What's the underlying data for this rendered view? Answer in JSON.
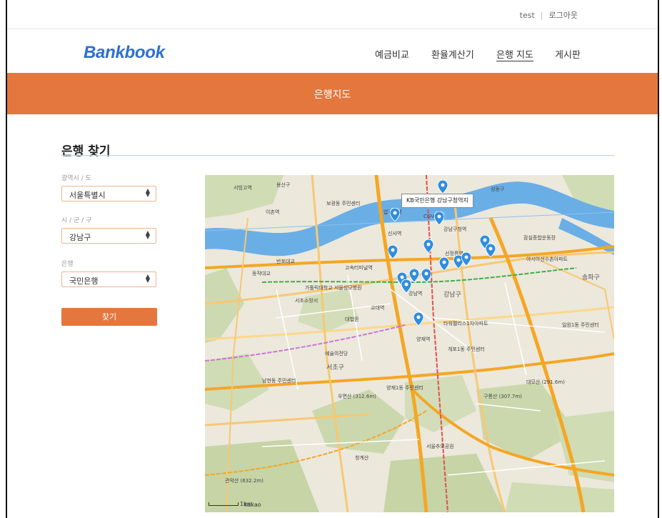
{
  "top_links": {
    "user": "test",
    "logout": "로그아웃"
  },
  "brand": {
    "logo": "Bankbook",
    "color": "#2d6fd0"
  },
  "nav": [
    {
      "label": "예금비교"
    },
    {
      "label": "환율계산기"
    },
    {
      "label": "은행 지도",
      "active": true
    },
    {
      "label": "게시판"
    }
  ],
  "banner": {
    "title": "은행지도",
    "color": "#e4773e"
  },
  "search": {
    "title": "은행 찾기",
    "province_label": "광역시 / 도",
    "province_value": "서울특별시",
    "district_label": "시 / 군 / 구",
    "district_value": "강남구",
    "bank_label": "은행",
    "bank_value": "국민은행",
    "submit_label": "찾기"
  },
  "map": {
    "tooltip": "KB국민은행 강남구청역지",
    "scale_label": "1km",
    "brand": "kakao",
    "labels": [
      "용산구",
      "보광동 주민센터",
      "이촌역",
      "서빙고역",
      "반포대교",
      "성동구",
      "CGV",
      "압구정역",
      "신사역",
      "강남구청역",
      "잠실종합운동장",
      "아시아선수촌아파트",
      "동작대교",
      "가톨릭대학교 서울성모병원",
      "고속터미널역",
      "선정릉역",
      "서초소방서",
      "강남구",
      "송파구",
      "대법원",
      "교대역",
      "강남역",
      "타워팰리스1차아파트",
      "일원1동 주민센터",
      "예술의전당",
      "서초구",
      "양재역",
      "개포1동 주민센터",
      "남현동 주민센터",
      "우면산 (312.6m)",
      "양재1동 주민센터",
      "대모산 (291.6m)",
      "구룡산 (307.7m)",
      "관악산 (632.2m)",
      "서울추모공원",
      "청계산"
    ]
  }
}
